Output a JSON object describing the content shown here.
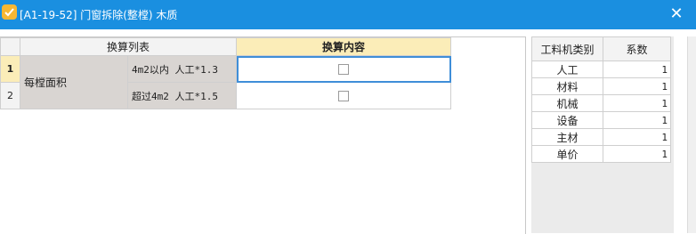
{
  "window": {
    "title": "[A1-19-52] 门窗拆除(整樘) 木质",
    "close_label": "✕"
  },
  "grid": {
    "header_list": "换算列表",
    "header_content": "换算内容",
    "group_label": "每樘面积",
    "rows": [
      {
        "num": "1",
        "label": "4m2以内 人工*1.3",
        "checked": false
      },
      {
        "num": "2",
        "label": "超过4m2 人工*1.5",
        "checked": false
      }
    ]
  },
  "factors": {
    "header_category": "工料机类别",
    "header_coef": "系数",
    "rows": [
      {
        "name": "人工",
        "value": "1"
      },
      {
        "name": "材料",
        "value": "1"
      },
      {
        "name": "机械",
        "value": "1"
      },
      {
        "name": "设备",
        "value": "1"
      },
      {
        "name": "主材",
        "value": "1"
      },
      {
        "name": "单价",
        "value": "1"
      }
    ]
  },
  "colors": {
    "titlebar": "#1a8fe0",
    "header_highlight": "#fbedb8",
    "group_fill": "#d9d5d2",
    "selection": "#3f8ed8"
  }
}
